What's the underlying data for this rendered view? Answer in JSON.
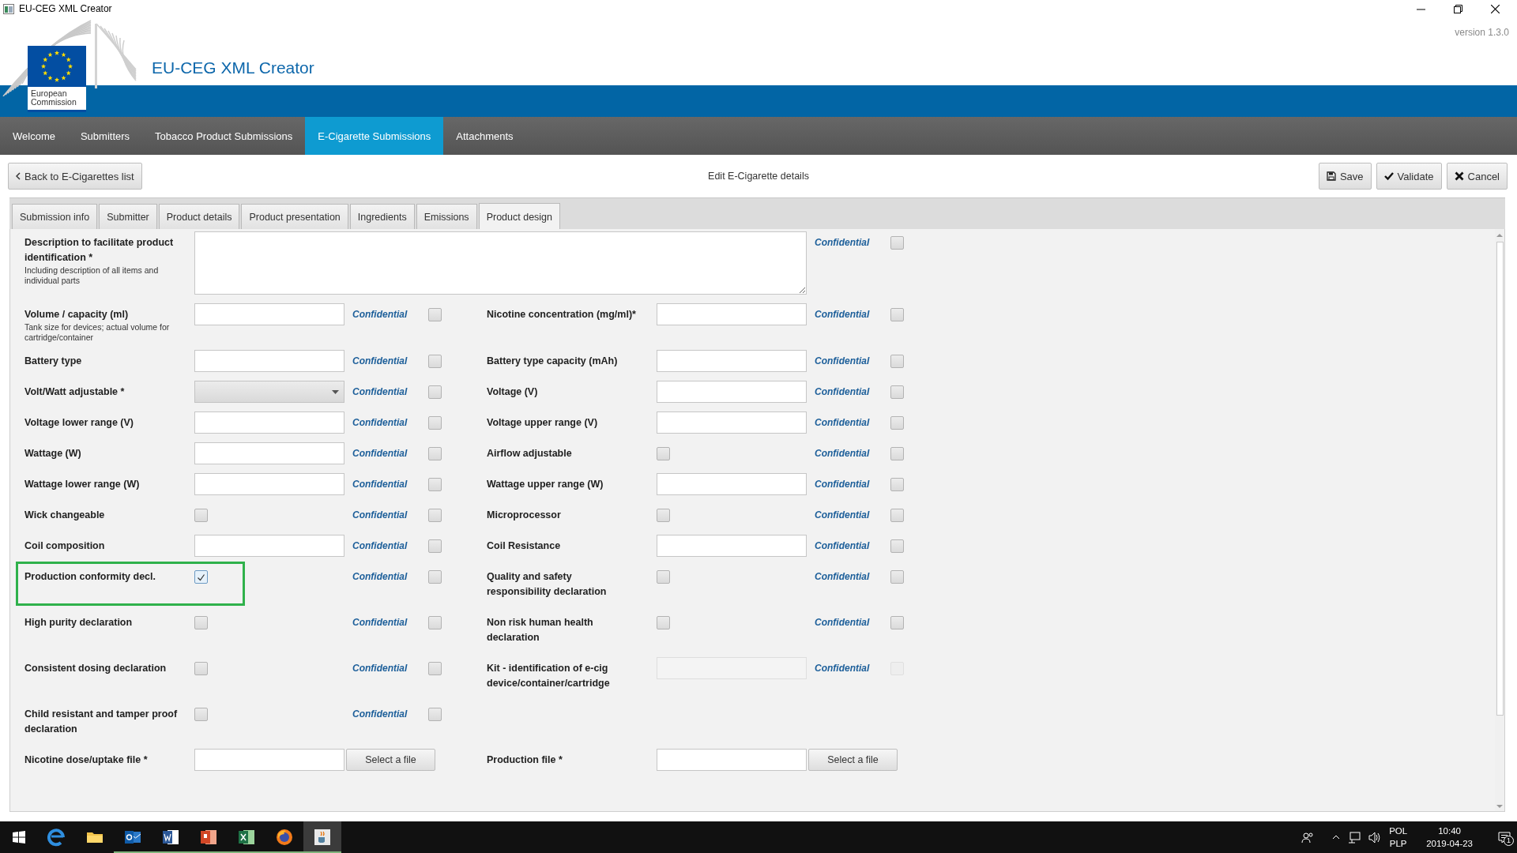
{
  "window": {
    "title": "EU-CEG XML Creator"
  },
  "header": {
    "logo_text": "European Commission",
    "title": "EU-CEG XML Creator",
    "version": "version 1.3.0"
  },
  "nav": [
    {
      "label": "Welcome",
      "selected": false
    },
    {
      "label": "Submitters",
      "selected": false
    },
    {
      "label": "Tobacco Product Submissions",
      "selected": false
    },
    {
      "label": "E-Cigarette Submissions",
      "selected": true
    },
    {
      "label": "Attachments",
      "selected": false
    }
  ],
  "toolbar": {
    "back": "Back to E-Cigarettes list",
    "heading": "Edit E-Cigarette details",
    "buttons": [
      {
        "kind": "save",
        "label": "Save"
      },
      {
        "kind": "validate",
        "label": "Validate"
      },
      {
        "kind": "cancel",
        "label": "Cancel"
      }
    ]
  },
  "tabs": [
    {
      "label": "Submission info",
      "selected": false
    },
    {
      "label": "Submitter",
      "selected": false
    },
    {
      "label": "Product details",
      "selected": false
    },
    {
      "label": "Product presentation",
      "selected": false
    },
    {
      "label": "Ingredients",
      "selected": false
    },
    {
      "label": "Emissions",
      "selected": false
    },
    {
      "label": "Product design",
      "selected": true
    }
  ],
  "form": {
    "rows": [
      {
        "cells": [
          {
            "kind": "textarea",
            "label": "Description to facilitate product identification *",
            "hint": "Including description of all items and individual parts",
            "confidential": {
              "label": "Confidential",
              "checked": false
            }
          }
        ]
      },
      {
        "cells": [
          {
            "kind": "text",
            "label": "Volume / capacity (ml)",
            "hint": "Tank size for devices; actual volume for cartridge/container",
            "confidential": {
              "label": "Confidential",
              "checked": false
            }
          },
          {
            "kind": "text",
            "label": "Nicotine concentration (mg/ml)*",
            "confidential": {
              "label": "Confidential",
              "checked": false
            }
          }
        ]
      },
      {
        "cells": [
          {
            "kind": "text",
            "label": "Battery type",
            "confidential": {
              "label": "Confidential",
              "checked": false
            }
          },
          {
            "kind": "text",
            "label": "Battery type capacity (mAh)",
            "confidential": {
              "label": "Confidential",
              "checked": false
            }
          }
        ]
      },
      {
        "cells": [
          {
            "kind": "select",
            "label": "Volt/Watt adjustable *",
            "confidential": {
              "label": "Confidential",
              "checked": false
            }
          },
          {
            "kind": "text",
            "label": "Voltage (V)",
            "confidential": {
              "label": "Confidential",
              "checked": false
            }
          }
        ]
      },
      {
        "cells": [
          {
            "kind": "text",
            "label": "Voltage lower range (V)",
            "confidential": {
              "label": "Confidential",
              "checked": false
            }
          },
          {
            "kind": "text",
            "label": "Voltage upper range (V)",
            "confidential": {
              "label": "Confidential",
              "checked": false
            }
          }
        ]
      },
      {
        "cells": [
          {
            "kind": "text",
            "label": "Wattage (W)",
            "confidential": {
              "label": "Confidential",
              "checked": false
            }
          },
          {
            "kind": "checkbox",
            "label": "Airflow adjustable",
            "checked": false,
            "confidential": {
              "label": "Confidential",
              "checked": false
            }
          }
        ]
      },
      {
        "cells": [
          {
            "kind": "text",
            "label": "Wattage lower range (W)",
            "confidential": {
              "label": "Confidential",
              "checked": false
            }
          },
          {
            "kind": "text",
            "label": "Wattage upper range (W)",
            "confidential": {
              "label": "Confidential",
              "checked": false
            }
          }
        ]
      },
      {
        "cells": [
          {
            "kind": "checkbox",
            "label": "Wick changeable",
            "checked": false,
            "confidential": {
              "label": "Confidential",
              "checked": false
            }
          },
          {
            "kind": "checkbox",
            "label": "Microprocessor",
            "checked": false,
            "confidential": {
              "label": "Confidential",
              "checked": false
            }
          }
        ]
      },
      {
        "cells": [
          {
            "kind": "text",
            "label": "Coil composition",
            "confidential": {
              "label": "Confidential",
              "checked": false
            }
          },
          {
            "kind": "text",
            "label": "Coil Resistance",
            "confidential": {
              "label": "Confidential",
              "checked": false
            }
          }
        ]
      },
      {
        "cells": [
          {
            "kind": "checkbox",
            "label": "Production conformity decl.",
            "checked": true,
            "highlighted": true,
            "confidential": {
              "label": "Confidential",
              "checked": false
            }
          },
          {
            "kind": "checkbox",
            "label": "Quality and safety responsibility declaration",
            "checked": false,
            "confidential": {
              "label": "Confidential",
              "checked": false
            }
          }
        ]
      },
      {
        "cells": [
          {
            "kind": "checkbox",
            "label": "High purity declaration",
            "checked": false,
            "confidential": {
              "label": "Confidential",
              "checked": false
            }
          },
          {
            "kind": "checkbox",
            "label": "Non risk human health declaration",
            "checked": false,
            "confidential": {
              "label": "Confidential",
              "checked": false
            }
          }
        ]
      },
      {
        "cells": [
          {
            "kind": "checkbox",
            "label": "Consistent dosing declaration",
            "checked": false,
            "confidential": {
              "label": "Confidential",
              "checked": false
            }
          },
          {
            "kind": "text",
            "label": "Kit - identification of e-cig device/container/cartridge",
            "disabled": true,
            "confidential": {
              "label": "Confidential",
              "checked": false,
              "disabled": true
            }
          }
        ]
      },
      {
        "cells": [
          {
            "kind": "checkbox",
            "label": "Child resistant and tamper proof declaration",
            "checked": false,
            "confidential": {
              "label": "Confidential",
              "checked": false
            }
          }
        ]
      },
      {
        "cells": [
          {
            "kind": "file",
            "label": "Nicotine dose/uptake file *",
            "button": "Select a file"
          },
          {
            "kind": "file",
            "label": "Production file *",
            "button": "Select a file"
          }
        ]
      }
    ]
  },
  "taskbar": {
    "apps": [
      {
        "kind": "edge",
        "running": false,
        "active": false
      },
      {
        "kind": "explorer",
        "running": false,
        "active": false
      },
      {
        "kind": "outlook",
        "running": true,
        "active": false
      },
      {
        "kind": "word",
        "running": true,
        "active": false
      },
      {
        "kind": "powerpoint",
        "running": true,
        "active": false
      },
      {
        "kind": "excel",
        "running": true,
        "active": false
      },
      {
        "kind": "firefox",
        "running": true,
        "active": false
      },
      {
        "kind": "java",
        "running": true,
        "active": true
      }
    ],
    "language": "POL",
    "layout": "PLP",
    "time": "10:40",
    "date": "2019-04-23",
    "notifications": "1"
  }
}
